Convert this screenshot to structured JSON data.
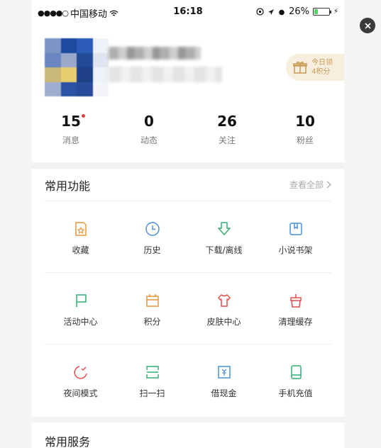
{
  "status_bar": {
    "carrier": "中国移动",
    "time": "16:18",
    "battery": "26%",
    "battery_level": 0.26
  },
  "profile": {
    "checkin_line1": "今日领",
    "checkin_line2": "4积分"
  },
  "stats": [
    {
      "value": "15",
      "label": "消息",
      "has_dot": true
    },
    {
      "value": "0",
      "label": "动态"
    },
    {
      "value": "26",
      "label": "关注"
    },
    {
      "value": "10",
      "label": "粉丝"
    }
  ],
  "functions": {
    "title": "常用功能",
    "view_all": "查看全部",
    "items": [
      {
        "label": "收藏",
        "icon": "favorite-icon",
        "color": "#e8973a"
      },
      {
        "label": "历史",
        "icon": "history-clock-icon",
        "color": "#4a90d9"
      },
      {
        "label": "下载/离线",
        "icon": "download-icon",
        "color": "#2fb174"
      },
      {
        "label": "小说书架",
        "icon": "bookshelf-icon",
        "color": "#4a90d9"
      },
      {
        "label": "活动中心",
        "icon": "flag-icon",
        "color": "#2fb174"
      },
      {
        "label": "积分",
        "icon": "points-icon",
        "color": "#e8973a"
      },
      {
        "label": "皮肤中心",
        "icon": "shirt-icon",
        "color": "#e54d4d"
      },
      {
        "label": "清理缓存",
        "icon": "clear-cache-icon",
        "color": "#e54d4d"
      },
      {
        "label": "夜间模式",
        "icon": "night-mode-icon",
        "color": "#e54d4d"
      },
      {
        "label": "扫一扫",
        "icon": "scan-icon",
        "color": "#2fb174"
      },
      {
        "label": "借现金",
        "icon": "cash-icon",
        "color": "#4a90d9"
      },
      {
        "label": "手机充值",
        "icon": "phone-recharge-icon",
        "color": "#2fb174"
      }
    ]
  },
  "services": {
    "title": "常用服务"
  }
}
